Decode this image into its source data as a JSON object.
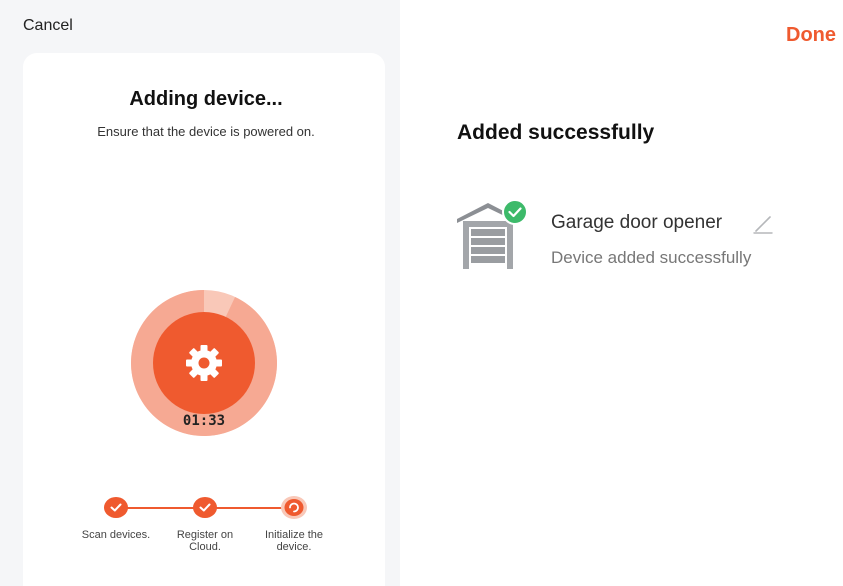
{
  "left": {
    "cancel_label": "Cancel",
    "title": "Adding device...",
    "subtitle": "Ensure that the device is powered on.",
    "timer": "01:33",
    "progress_fraction": 0.93,
    "steps": [
      {
        "label": "Scan devices.",
        "state": "done"
      },
      {
        "label": "Register on Cloud.",
        "state": "done"
      },
      {
        "label": "Initialize the device.",
        "state": "in-progress"
      }
    ]
  },
  "right": {
    "done_label": "Done",
    "title": "Added successfully",
    "device": {
      "name": "Garage door opener",
      "status": "Device added successfully",
      "icon": "garage-icon",
      "badge_icon": "check-circle-icon"
    }
  },
  "colors": {
    "accent": "#ef5a2f",
    "ring_light": "#f9c8b8",
    "ring_mid": "#f6b3a0",
    "success": "#3dba6a",
    "panel_bg": "#f5f6f8"
  }
}
